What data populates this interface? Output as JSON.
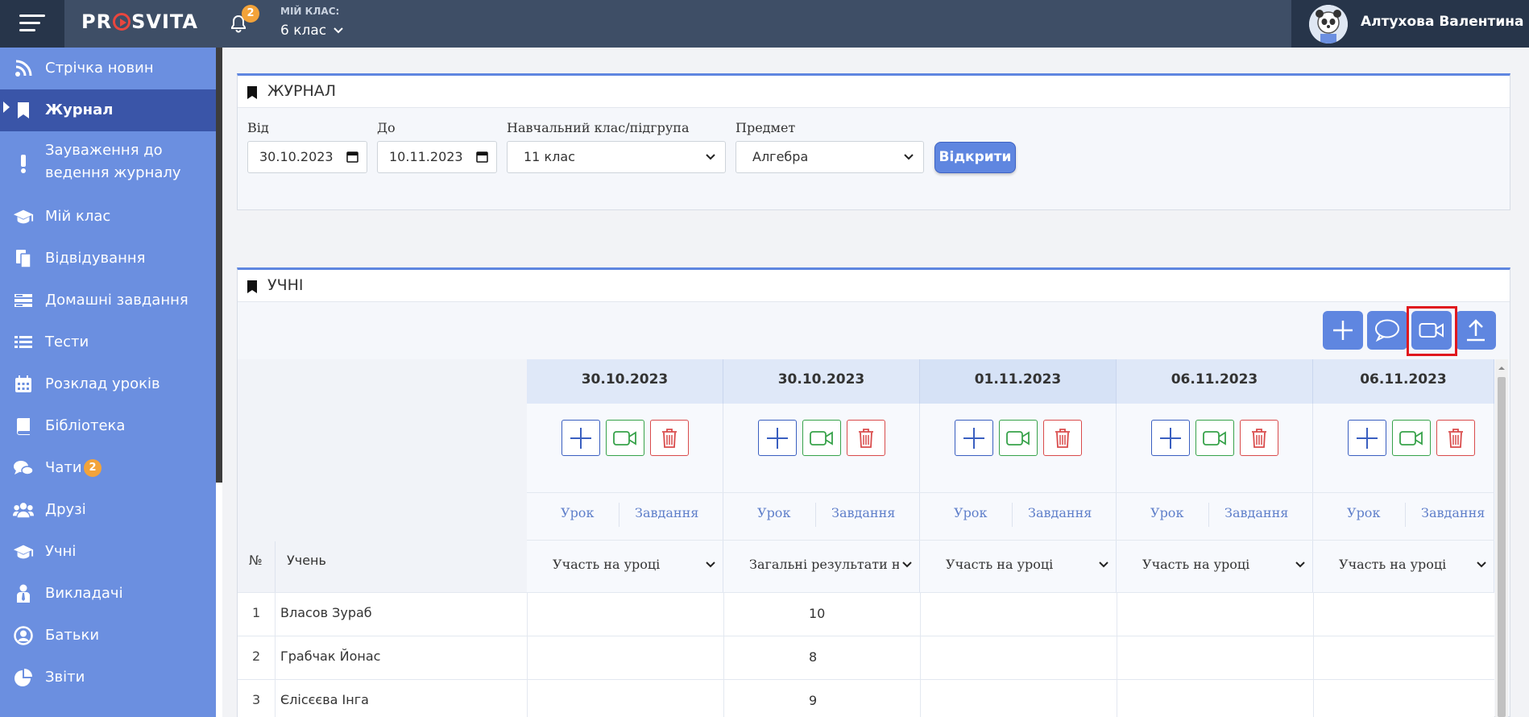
{
  "header": {
    "logo": "PROSVITA",
    "logo_part1": "PR",
    "logo_part2": "SVITA",
    "notifications_count": "2",
    "class_label": "МІЙ КЛАС:",
    "class_value": "6 клас",
    "user_name": "Алтухова Валентина"
  },
  "sidebar": {
    "items": [
      {
        "label": "Стрічка новин",
        "icon": "rss-icon"
      },
      {
        "label": "Журнал",
        "icon": "bookmark-icon"
      },
      {
        "label": "Зауваження до",
        "label2": "ведення журналу",
        "icon": "exclamation-icon"
      },
      {
        "label": "Мій клас",
        "icon": "graduation-cap-icon"
      },
      {
        "label": "Відвідування",
        "icon": "documents-icon"
      },
      {
        "label": "Домашні завдання",
        "icon": "homework-icon"
      },
      {
        "label": "Тести",
        "icon": "list-icon"
      },
      {
        "label": "Розклад уроків",
        "icon": "calendar-icon"
      },
      {
        "label": "Бібліотека",
        "icon": "book-icon"
      },
      {
        "label": "Чати",
        "icon": "chat-icon",
        "badge": "2"
      },
      {
        "label": "Друзі",
        "icon": "users-icon"
      },
      {
        "label": "Учні",
        "icon": "graduation-cap-icon"
      },
      {
        "label": "Викладачі",
        "icon": "teacher-icon"
      },
      {
        "label": "Батьки",
        "icon": "user-circle-icon"
      },
      {
        "label": "Звіти",
        "icon": "pie-chart-icon"
      }
    ]
  },
  "journal": {
    "title": "ЖУРНАЛ",
    "from_label": "Від",
    "from_value": "30.10.2023",
    "to_label": "До",
    "to_value": "10.11.2023",
    "class_label": "Навчальний клас/підгрупа",
    "class_value": "11 клас",
    "subject_label": "Предмет",
    "subject_value": "Алгебра",
    "open_button": "Відкрити"
  },
  "students": {
    "title": "УЧНІ",
    "num_header": "№",
    "name_header": "Учень",
    "tab_lesson": "Урок",
    "tab_task": "Завдання",
    "columns": [
      {
        "date": "30.10.2023",
        "select": "Участь на уроці"
      },
      {
        "date": "30.10.2023",
        "select": "Загальні результати н"
      },
      {
        "date": "01.11.2023",
        "select": "Участь на уроці"
      },
      {
        "date": "06.11.2023",
        "select": "Участь на уроці"
      },
      {
        "date": "06.11.2023",
        "select": "Участь на уроці"
      }
    ],
    "rows": [
      {
        "num": "1",
        "name": "Власов Зураб",
        "grade": "10"
      },
      {
        "num": "2",
        "name": "Грабчак Йонас",
        "grade": "8"
      },
      {
        "num": "3",
        "name": "Єлісєєва Інга",
        "grade": "9"
      }
    ]
  },
  "colors": {
    "sidebar": "#6b8fe0",
    "sidebar_active": "#3a55a8",
    "topbar": "#3e4e66",
    "accent": "#5f86e0",
    "highlight": "#e0181e"
  }
}
